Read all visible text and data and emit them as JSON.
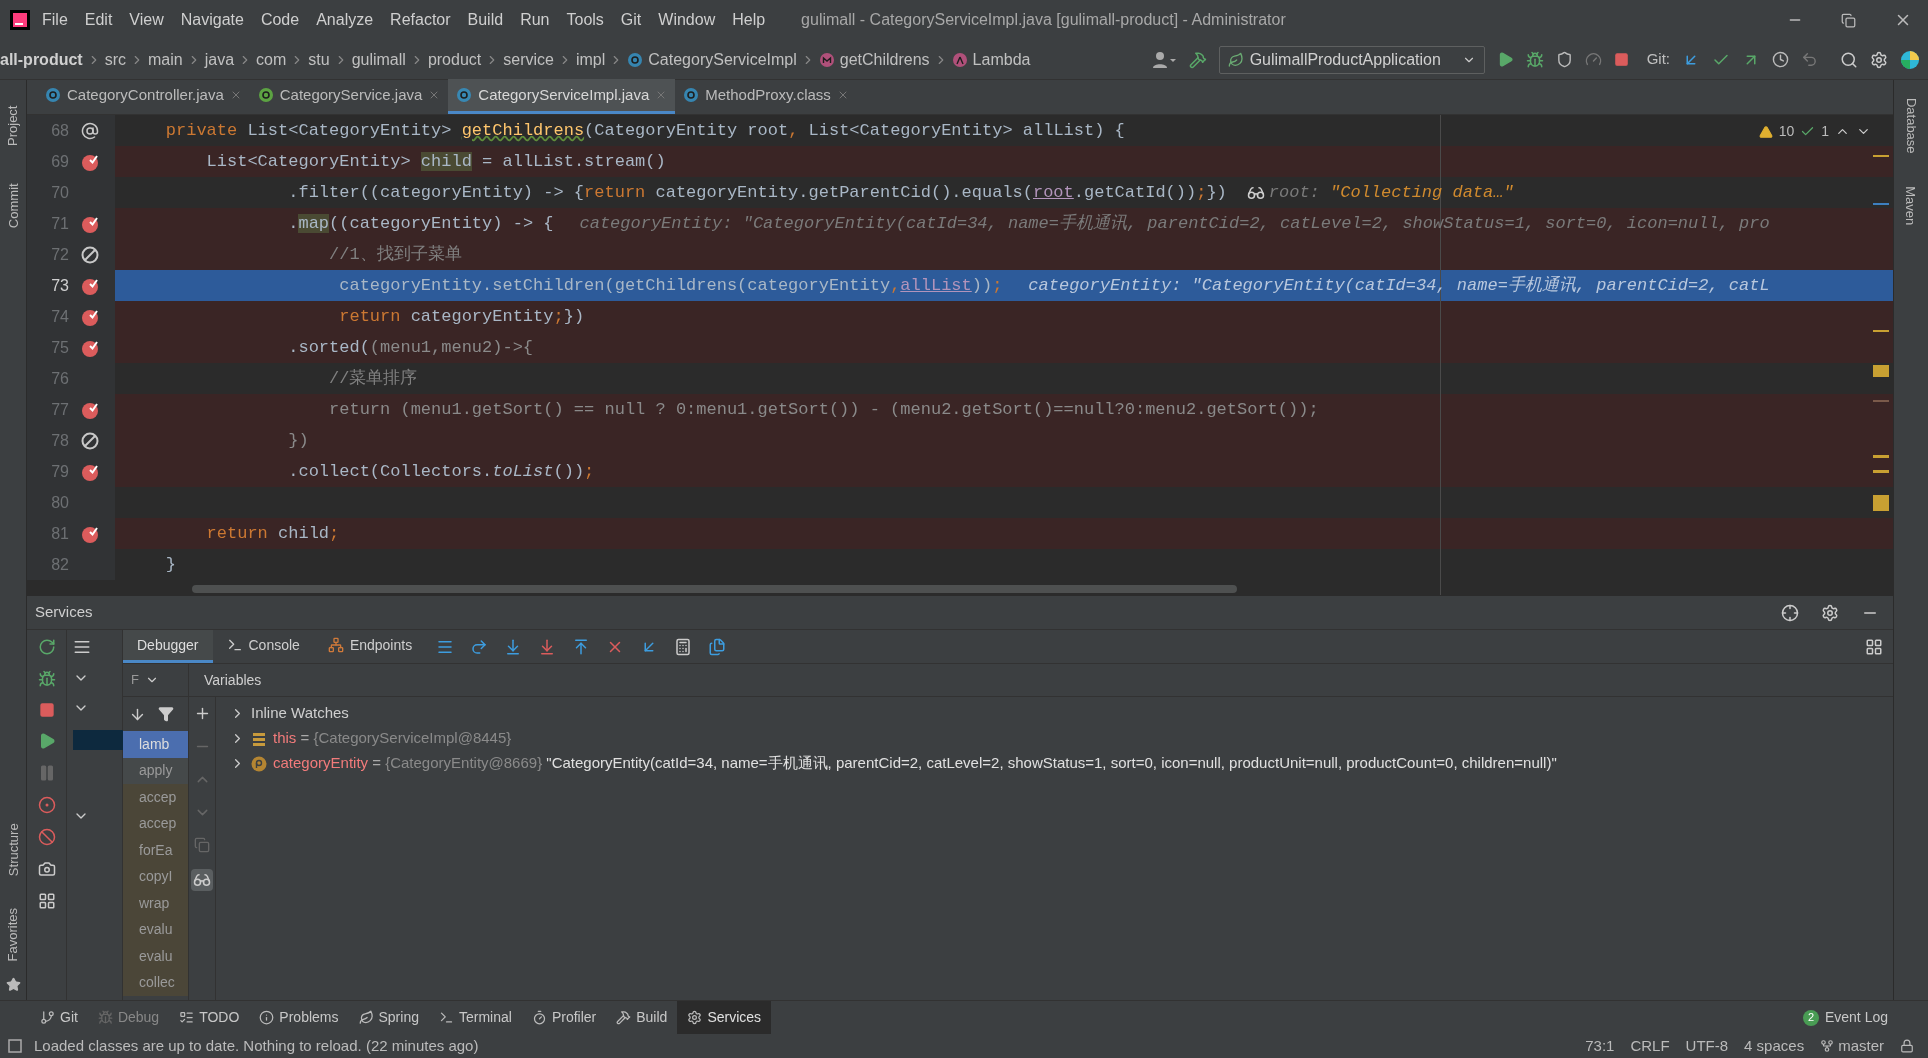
{
  "menu": [
    "File",
    "Edit",
    "View",
    "Navigate",
    "Code",
    "Analyze",
    "Refactor",
    "Build",
    "Run",
    "Tools",
    "Git",
    "Window",
    "Help"
  ],
  "window_title": "gulimall - CategoryServiceImpl.java [gulimall-product] - Administrator",
  "breadcrumbs": [
    {
      "label": "all-product",
      "kind": "module"
    },
    {
      "label": "src",
      "kind": "folder"
    },
    {
      "label": "main",
      "kind": "folder"
    },
    {
      "label": "java",
      "kind": "folder"
    },
    {
      "label": "com",
      "kind": "folder"
    },
    {
      "label": "stu",
      "kind": "folder"
    },
    {
      "label": "gulimall",
      "kind": "folder"
    },
    {
      "label": "product",
      "kind": "folder"
    },
    {
      "label": "service",
      "kind": "folder"
    },
    {
      "label": "impl",
      "kind": "folder"
    },
    {
      "label": "CategoryServiceImpl",
      "kind": "class"
    },
    {
      "label": "getChildrens",
      "kind": "method"
    },
    {
      "label": "Lambda",
      "kind": "lambda"
    }
  ],
  "run_config": "GulimallProductApplication",
  "git_label": "Git:",
  "tabs": [
    {
      "label": "CategoryController.java",
      "kind": "class",
      "selected": false
    },
    {
      "label": "CategoryService.java",
      "kind": "interface",
      "selected": false
    },
    {
      "label": "CategoryServiceImpl.java",
      "kind": "class",
      "selected": true
    },
    {
      "label": "MethodProxy.class",
      "kind": "compiled",
      "selected": false
    }
  ],
  "left_stripe_top": [
    "Project",
    "Commit"
  ],
  "left_stripe_bottom": [
    "Structure",
    "Favorites"
  ],
  "right_stripe": [
    "Database",
    "Maven"
  ],
  "inspections": {
    "warnings": "10",
    "typos": "1"
  },
  "code_lines": [
    {
      "number": "68",
      "kind": "override",
      "current": false,
      "tokens": [
        {
          "kind": "kw",
          "text": "    private "
        },
        {
          "kind": "plain",
          "text": "List<CategoryEntity> "
        },
        {
          "kind": "decl",
          "text": "getChildrens"
        },
        {
          "kind": "plain",
          "text": "(CategoryEntity root"
        },
        {
          "kind": "kw",
          "text": ", "
        },
        {
          "kind": "plain",
          "text": "List<CategoryEntity> allList) {"
        }
      ]
    },
    {
      "number": "69",
      "kind": "breakpoint",
      "current": false,
      "tokens": [
        {
          "kind": "plain",
          "text": "        List<CategoryEntity> "
        },
        {
          "kind": "mark",
          "text": "child"
        },
        {
          "kind": "plain",
          "text": " = allList.stream()"
        }
      ]
    },
    {
      "number": "70",
      "kind": "plain",
      "current": false,
      "tokens": [
        {
          "kind": "plain",
          "text": "                .filter((categoryEntity) -> {"
        },
        {
          "kind": "kw",
          "text": "return "
        },
        {
          "kind": "plain",
          "text": "categoryEntity.getParentCid().equals("
        },
        {
          "kind": "ref",
          "text": "root"
        },
        {
          "kind": "plain",
          "text": ".getCatId())"
        },
        {
          "kind": "kw",
          "text": ";"
        },
        {
          "kind": "plain",
          "text": "})"
        }
      ],
      "hint": {
        "watch": true,
        "label": "root: ",
        "value": "\"Collecting data…\""
      }
    },
    {
      "number": "71",
      "kind": "breakpoint",
      "current": false,
      "tokens": [
        {
          "kind": "plain",
          "text": "                ."
        },
        {
          "kind": "mark",
          "text": "map"
        },
        {
          "kind": "plain",
          "text": "((categoryEntity) -> {"
        }
      ],
      "hint": {
        "watch": false,
        "label": "categoryEntity: \"CategoryEntity(catId=34, name=手机通讯, parentCid=2, catLevel=2, showStatus=1, sort=0, icon=null, pro"
      }
    },
    {
      "number": "72",
      "kind": "muted",
      "current": false,
      "tokens": [
        {
          "kind": "comment",
          "text": "                    //1、找到子菜单"
        }
      ]
    },
    {
      "number": "73",
      "kind": "breakpoint",
      "current": true,
      "tokens": [
        {
          "kind": "plain",
          "text": "                     categoryEntity.setChildren(getChildrens(categoryEntity"
        },
        {
          "kind": "kw",
          "text": ","
        },
        {
          "kind": "ref",
          "text": "allList"
        },
        {
          "kind": "plain",
          "text": "))"
        },
        {
          "kind": "kw",
          "text": ";"
        }
      ],
      "hint": {
        "watch": false,
        "label": "categoryEntity: \"CategoryEntity(catId=34, name=手机通讯, parentCid=2, catL"
      }
    },
    {
      "number": "74",
      "kind": "breakpoint",
      "current": false,
      "tokens": [
        {
          "kind": "kw",
          "text": "                     return "
        },
        {
          "kind": "plain",
          "text": "categoryEntity"
        },
        {
          "kind": "kw",
          "text": ";"
        },
        {
          "kind": "plain",
          "text": "})"
        }
      ]
    },
    {
      "number": "75",
      "kind": "breakpoint",
      "current": false,
      "tokens": [
        {
          "kind": "plain",
          "text": "                .sorted("
        },
        {
          "kind": "dim",
          "text": "(menu1,menu2)->{"
        }
      ]
    },
    {
      "number": "76",
      "kind": "plain",
      "current": false,
      "tokens": [
        {
          "kind": "comment",
          "text": "                    //菜单排序"
        }
      ]
    },
    {
      "number": "77",
      "kind": "breakpoint",
      "current": false,
      "tokens": [
        {
          "kind": "dim",
          "text": "                    return (menu1.getSort() == null ? 0:menu1.getSort()) - (menu2.getSort()==null?0:menu2.getSort());"
        }
      ]
    },
    {
      "number": "78",
      "kind": "muted",
      "current": false,
      "tokens": [
        {
          "kind": "dim",
          "text": "                })"
        }
      ]
    },
    {
      "number": "79",
      "kind": "breakpoint",
      "current": false,
      "tokens": [
        {
          "kind": "plain",
          "text": "                .collect(Collectors."
        },
        {
          "kind": "static",
          "text": "toList"
        },
        {
          "kind": "plain",
          "text": "())"
        },
        {
          "kind": "kw",
          "text": ";"
        }
      ]
    },
    {
      "number": "80",
      "kind": "plain",
      "current": false
    },
    {
      "number": "81",
      "kind": "breakpoint",
      "current": false,
      "tokens": [
        {
          "kind": "kw",
          "text": "        return "
        },
        {
          "kind": "plain",
          "text": "child"
        },
        {
          "kind": "kw",
          "text": ";"
        }
      ]
    },
    {
      "number": "82",
      "kind": "plain",
      "current": false,
      "tokens": [
        {
          "kind": "plain",
          "text": "    }"
        }
      ]
    }
  ],
  "services": {
    "title": "Services",
    "tabs": [
      {
        "label": "Debugger",
        "kind": "debugger",
        "selected": true
      },
      {
        "label": "Console",
        "kind": "console",
        "selected": false
      },
      {
        "label": "Endpoints",
        "kind": "endpoints",
        "selected": false
      }
    ],
    "frames_dropdown": "F",
    "frames": [
      {
        "label": "lamb",
        "selected": true,
        "library": false
      },
      {
        "label": "apply",
        "selected": false,
        "library": false
      },
      {
        "label": "accep",
        "selected": false,
        "library": true
      },
      {
        "label": "accep",
        "selected": false,
        "library": true
      },
      {
        "label": "forEa",
        "selected": false,
        "library": true
      },
      {
        "label": "copyI",
        "selected": false,
        "library": true
      },
      {
        "label": "wrap",
        "selected": false,
        "library": true
      },
      {
        "label": "evalu",
        "selected": false,
        "library": true
      },
      {
        "label": "evalu",
        "selected": false,
        "library": true
      },
      {
        "label": "collec",
        "selected": false,
        "library": true
      }
    ],
    "variables_header": "Variables",
    "variables": [
      {
        "kind": "watches",
        "name": "Inline Watches"
      },
      {
        "kind": "field",
        "name": "this",
        "operator": "=",
        "ref": "{CategoryServiceImpl@8445}"
      },
      {
        "kind": "param",
        "name": "categoryEntity",
        "operator": "=",
        "ref": "{CategoryEntity@8669}",
        "value": "\"CategoryEntity(catId=34, name=手机通讯, parentCid=2, catLevel=2, showStatus=1, sort=0, icon=null, productUnit=null, productCount=0, children=null)\""
      }
    ]
  },
  "tool_windows": [
    {
      "label": "Git",
      "kind": "git",
      "selected": false,
      "disabled": false
    },
    {
      "label": "Debug",
      "kind": "debug",
      "selected": false,
      "disabled": true
    },
    {
      "label": "TODO",
      "kind": "todo",
      "selected": false,
      "disabled": false
    },
    {
      "label": "Problems",
      "kind": "problems",
      "selected": false,
      "disabled": false
    },
    {
      "label": "Spring",
      "kind": "spring",
      "selected": false,
      "disabled": false
    },
    {
      "label": "Terminal",
      "kind": "terminal",
      "selected": false,
      "disabled": false
    },
    {
      "label": "Profiler",
      "kind": "profiler",
      "selected": false,
      "disabled": false
    },
    {
      "label": "Build",
      "kind": "build",
      "selected": false,
      "disabled": false
    },
    {
      "label": "Services",
      "kind": "services",
      "selected": true,
      "disabled": false
    }
  ],
  "event_log": {
    "label": "Event Log",
    "count": "2"
  },
  "status": {
    "message": "Loaded classes are up to date. Nothing to reload. (22 minutes ago)",
    "position": "73:1",
    "line_separator": "CRLF",
    "encoding": "UTF-8",
    "indent": "4 spaces",
    "branch": "master"
  }
}
